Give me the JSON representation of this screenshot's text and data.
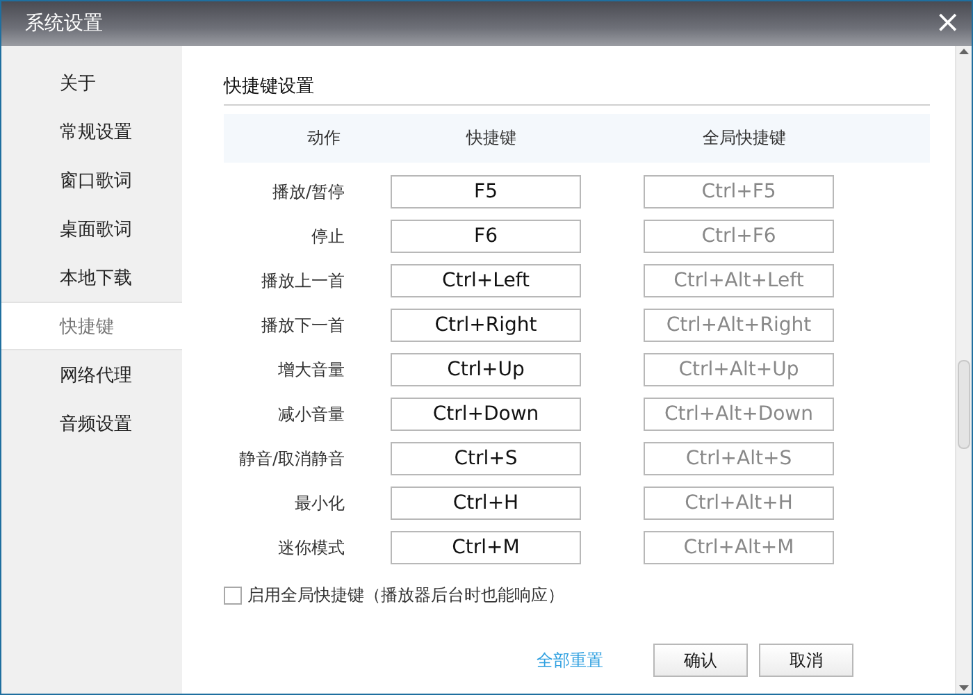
{
  "window": {
    "title": "系统设置",
    "close": "×"
  },
  "sidebar": {
    "items": [
      {
        "label": "关于",
        "selected": false
      },
      {
        "label": "常规设置",
        "selected": false
      },
      {
        "label": "窗口歌词",
        "selected": false
      },
      {
        "label": "桌面歌词",
        "selected": false
      },
      {
        "label": "本地下载",
        "selected": false
      },
      {
        "label": "快捷键",
        "selected": true
      },
      {
        "label": "网络代理",
        "selected": false
      },
      {
        "label": "音频设置",
        "selected": false
      }
    ]
  },
  "section": {
    "title": "快捷键设置"
  },
  "table": {
    "columns": [
      "动作",
      "快捷键",
      "全局快捷键"
    ],
    "rows": [
      {
        "action": "播放/暂停",
        "hotkey": "F5",
        "global": "Ctrl+F5"
      },
      {
        "action": "停止",
        "hotkey": "F6",
        "global": "Ctrl+F6"
      },
      {
        "action": "播放上一首",
        "hotkey": "Ctrl+Left",
        "global": "Ctrl+Alt+Left"
      },
      {
        "action": "播放下一首",
        "hotkey": "Ctrl+Right",
        "global": "Ctrl+Alt+Right"
      },
      {
        "action": "增大音量",
        "hotkey": "Ctrl+Up",
        "global": "Ctrl+Alt+Up"
      },
      {
        "action": "减小音量",
        "hotkey": "Ctrl+Down",
        "global": "Ctrl+Alt+Down"
      },
      {
        "action": "静音/取消静音",
        "hotkey": "Ctrl+S",
        "global": "Ctrl+Alt+S"
      },
      {
        "action": "最小化",
        "hotkey": "Ctrl+H",
        "global": "Ctrl+Alt+H"
      },
      {
        "action": "迷你模式",
        "hotkey": "Ctrl+M",
        "global": "Ctrl+Alt+M"
      }
    ]
  },
  "global_option": {
    "label": "启用全局快捷键（播放器后台时也能响应）",
    "checked": false
  },
  "footer": {
    "reset_link": "全部重置",
    "buttons": [
      "确认",
      "取消"
    ]
  }
}
